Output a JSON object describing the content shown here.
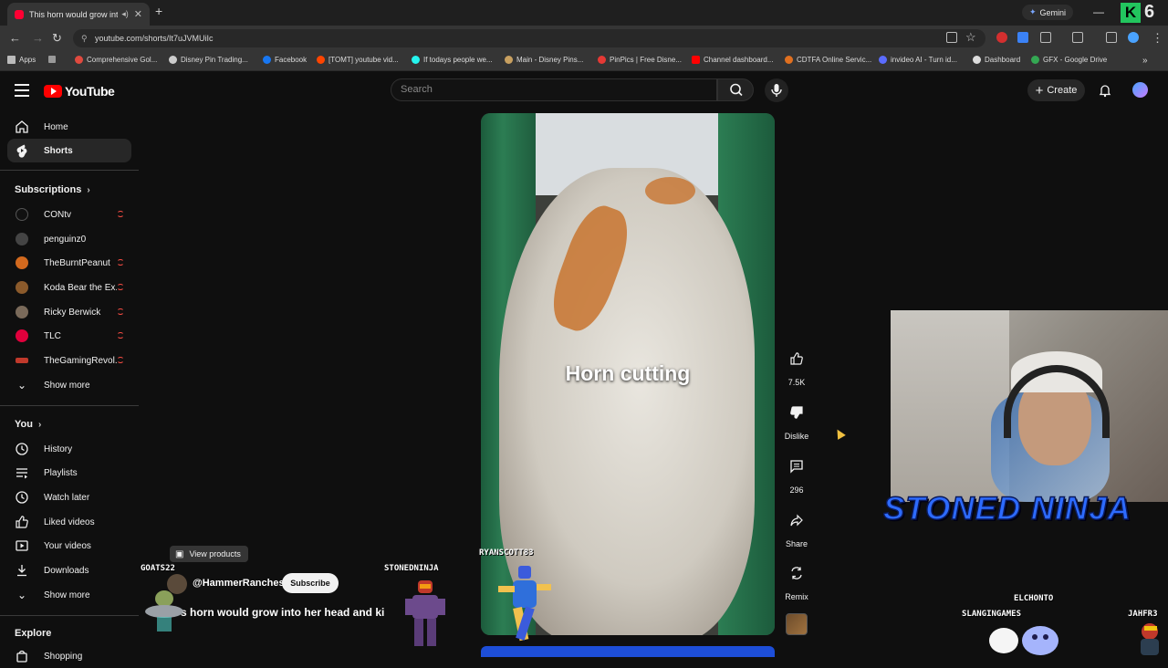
{
  "browser": {
    "tab_title": "This horn would grow into",
    "gemini_label": "Gemini",
    "url": "youtube.com/shorts/It7uJVMUiIc",
    "k_badge": "K",
    "k_count": "6",
    "bookmarks": [
      {
        "label": "Apps",
        "color": "#bbbbbb"
      },
      {
        "label": "Comprehensive Gol...",
        "color": "#e04a3f"
      },
      {
        "label": "Disney Pin Trading...",
        "color": "#cccccc"
      },
      {
        "label": "Facebook",
        "color": "#1877f2"
      },
      {
        "label": "[TOMT] youtube vid...",
        "color": "#ff4500"
      },
      {
        "label": "If todays people we...",
        "color": "#25f4ee"
      },
      {
        "label": "Main - Disney Pins...",
        "color": "#c8a060"
      },
      {
        "label": "PinPics | Free Disne...",
        "color": "#e53935"
      },
      {
        "label": "Channel dashboard...",
        "color": "#ff0000"
      },
      {
        "label": "CDTFA Online Servic...",
        "color": "#e07020"
      },
      {
        "label": "invideo AI - Turn id...",
        "color": "#5b6cff"
      },
      {
        "label": "Dashboard",
        "color": "#dddddd"
      },
      {
        "label": "GFX - Google Drive",
        "color": "#34a853"
      }
    ]
  },
  "header": {
    "logo_text": "YouTube",
    "search_placeholder": "Search",
    "create_label": "Create"
  },
  "sidebar": {
    "main": [
      {
        "label": "Home",
        "icon": "home-icon"
      },
      {
        "label": "Shorts",
        "icon": "shorts-icon"
      }
    ],
    "subscriptions_title": "Subscriptions",
    "subscriptions": [
      {
        "label": "CONtv",
        "color": "#111111"
      },
      {
        "label": "penguinz0",
        "color": "#444444"
      },
      {
        "label": "TheBurntPeanut",
        "color": "#d2691e"
      },
      {
        "label": "Koda Bear the Ex...",
        "color": "#8b5a2b"
      },
      {
        "label": "Ricky Berwick",
        "color": "#7a6a5a"
      },
      {
        "label": "TLC",
        "color": "#e0003c"
      },
      {
        "label": "TheGamingRevol...",
        "color": "#c0392b"
      }
    ],
    "show_more": "Show more",
    "you_title": "You",
    "you_items": [
      {
        "label": "History",
        "icon": "history-icon"
      },
      {
        "label": "Playlists",
        "icon": "playlists-icon"
      },
      {
        "label": "Watch later",
        "icon": "clock-icon"
      },
      {
        "label": "Liked videos",
        "icon": "thumbs-up-icon"
      },
      {
        "label": "Your videos",
        "icon": "video-icon"
      },
      {
        "label": "Downloads",
        "icon": "download-icon"
      }
    ],
    "show_more_2": "Show more",
    "explore_title": "Explore",
    "explore_items": [
      {
        "label": "Shopping",
        "icon": "shopping-icon"
      }
    ]
  },
  "short": {
    "caption": "Horn cutting",
    "likes": "7.5K",
    "dislike_label": "Dislike",
    "comments": "296",
    "share_label": "Share",
    "remix_label": "Remix",
    "view_products": "View products",
    "channel_handle": "@HammerRanches",
    "subscribe_label": "Subscribe",
    "description": "s horn would grow into her head and ki"
  },
  "stream_overlay": {
    "brand_text": "STONED NINJA",
    "names": {
      "goats": "GOATS22",
      "stonedninja": "STONEDNINJA",
      "ryanscott": "RYANSCOTT83",
      "elchonto": "ELCHONTO",
      "slangin": "SLANGINGAMES",
      "jahfr": "JAHFR3"
    }
  }
}
